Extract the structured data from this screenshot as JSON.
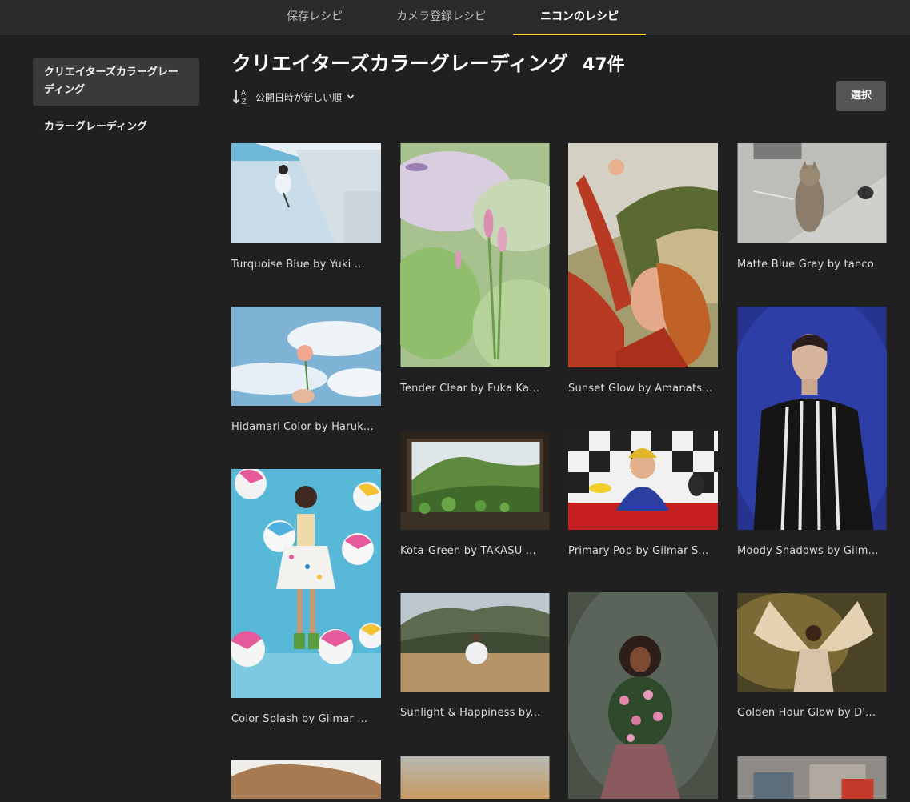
{
  "tabs": [
    {
      "label": "保存レシピ",
      "active": false
    },
    {
      "label": "カメラ登録レシピ",
      "active": false
    },
    {
      "label": "ニコンのレシピ",
      "active": true
    }
  ],
  "sidebar": {
    "items": [
      {
        "label": "クリエイターズカラーグレーディング",
        "active": true
      },
      {
        "label": "カラーグレーディング",
        "active": false
      }
    ]
  },
  "main": {
    "title": "クリエイターズカラーグレーディング",
    "count": "47件",
    "sort_label": "公開日時が新しい順",
    "sort_icon": "sort-descending-az-icon",
    "select_button": "選択"
  },
  "colors": {
    "background": "#202020",
    "topbar": "#2b2b2b",
    "accent": "#f2d21c",
    "button": "#555555"
  },
  "recipes": [
    {
      "caption": "Turquoise Blue by Yuki ...",
      "thumbnail": "girl-jumping-by-pool"
    },
    {
      "caption": "Tender Clear by Fuka Ka...",
      "thumbnail": "pink-flowers-field"
    },
    {
      "caption": "Sunset Glow by Amanats...",
      "thumbnail": "woman-in-red-stretching"
    },
    {
      "caption": "Matte Blue Gray by tanco",
      "thumbnail": "cat-on-floor"
    },
    {
      "caption": "Hidamari Color by Haruk...",
      "thumbnail": "flower-against-sky"
    },
    {
      "caption": "Kota-Green by TAKASU ...",
      "thumbnail": "window-with-plants"
    },
    {
      "caption": "Primary Pop by Gilmar S...",
      "thumbnail": "girl-with-yellow-phone"
    },
    {
      "caption": "Moody Shadows by Gilm...",
      "thumbnail": "man-blue-background"
    },
    {
      "caption": "Color Splash by Gilmar ...",
      "thumbnail": "girl-with-beach-balls"
    },
    {
      "caption": "Sunlight & Happiness by...",
      "thumbnail": "woman-in-field"
    },
    {
      "caption": "",
      "thumbnail": "woman-with-flowers"
    },
    {
      "caption": "Golden Hour Glow by D'...",
      "thumbnail": "woman-with-wings"
    },
    {
      "caption": "",
      "thumbnail": "desert-dune"
    },
    {
      "caption": "",
      "thumbnail": "sunset-sky"
    },
    {
      "caption": "",
      "thumbnail": "street-scene"
    }
  ]
}
